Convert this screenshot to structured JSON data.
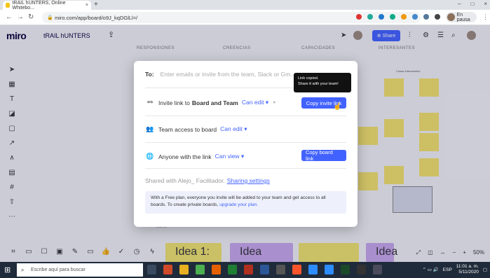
{
  "browser": {
    "tab_title": "tRAIL hUNTERS, Online Whitebo...",
    "tab_close": "×",
    "new_tab": "+",
    "url": "miro.com/app/board/o9J_kqDGlLl=/",
    "profile_label": "En pausa",
    "window_controls": [
      "–",
      "□",
      "×"
    ]
  },
  "miro": {
    "logo": "miro",
    "board_name": "tRAIL hUNTERS",
    "share_label": "Share",
    "column_headers": [
      "RESPONSIONES",
      "CREENCIAS",
      "CAPACIDADES",
      "INTERESANTES"
    ],
    "sticky_note_header": "Cosas Interesantes",
    "bottom_cards": [
      "Idea 1:",
      "Idea",
      "Idea"
    ],
    "zoom": "50%",
    "bottom_card_fragment": "IDEAL"
  },
  "modal": {
    "to_label": "To:",
    "to_placeholder": "Enter emails or invite from the team, Slack or Gm...",
    "invite_prefix": "Invite link to",
    "invite_target": "Board and Team",
    "invite_permission": "Can edit",
    "copy_invite_button": "Copy invite link",
    "team_access_label": "Team access to board",
    "team_permission": "Can edit",
    "anyone_label": "Anyone with the link",
    "anyone_permission": "Can view",
    "copy_board_button": "Copy board link",
    "shared_with": "Shared with Alejo_ Facilitador.",
    "sharing_settings": "Sharing settings",
    "info_text": "With a Free plan, everyone you invite will be added to your team and get access to all boards. To create private boards,",
    "upgrade_link": "upgrade your plan.",
    "tooltip_line1": "Link copied.",
    "tooltip_line2": "Share it with your team!"
  },
  "taskbar": {
    "search_placeholder": "Escribe aquí para buscar",
    "language": "ESP",
    "time": "11:01 a. m.",
    "date": "5/11/2020"
  }
}
